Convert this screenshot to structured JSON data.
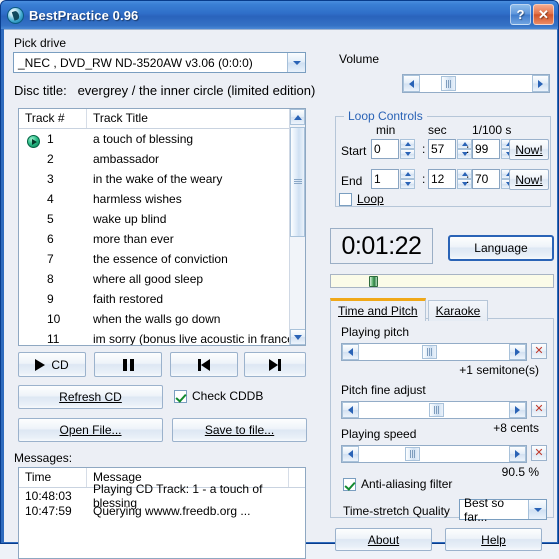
{
  "window": {
    "title": "BestPractice 0.96",
    "icon": "cd-disc-icon",
    "help_button": "?",
    "close_button": "✕"
  },
  "drive": {
    "label": "Pick drive",
    "selected": "_NEC   , DVD_RW ND-3520AW v3.06 (0:0:0)"
  },
  "disc": {
    "label": "Disc title:",
    "title": "evergrey / the inner circle (limited edition)"
  },
  "tracklist": {
    "columns": [
      "Track #",
      "Track Title"
    ],
    "playing_index": 1,
    "rows": [
      {
        "num": "1",
        "title": "a touch of blessing"
      },
      {
        "num": "2",
        "title": "ambassador"
      },
      {
        "num": "3",
        "title": "in the wake of the weary"
      },
      {
        "num": "4",
        "title": "harmless wishes"
      },
      {
        "num": "5",
        "title": "wake up blind"
      },
      {
        "num": "6",
        "title": "more than ever"
      },
      {
        "num": "7",
        "title": "the essence of conviction"
      },
      {
        "num": "8",
        "title": "where all good sleep"
      },
      {
        "num": "9",
        "title": "faith restored"
      },
      {
        "num": "10",
        "title": "when the walls go down"
      },
      {
        "num": "11",
        "title": "im sorry (bonus live acoustic in france)"
      }
    ]
  },
  "transport": {
    "play_label": "CD",
    "pause_label": "",
    "prev_label": "",
    "next_label": "",
    "refresh_label": "Refresh CD",
    "open_label": "Open File...",
    "save_label": "Save to file...",
    "check_cddb_label": "Check CDDB",
    "check_cddb_checked": true
  },
  "messages": {
    "label": "Messages:",
    "columns": [
      "Time",
      "Message"
    ],
    "rows": [
      {
        "time": "10:48:03",
        "message": "Playing CD Track: 1 - a touch of blessing"
      },
      {
        "time": "10:47:59",
        "message": "Querying wwww.freedb.org ..."
      }
    ]
  },
  "volume": {
    "label": "Volume",
    "thumb_percent": 22
  },
  "loop": {
    "title": "Loop Controls",
    "col_min": "min",
    "col_sec": "sec",
    "col_cent": "1/100 s",
    "start_label": "Start",
    "end_label": "End",
    "start_min": "0",
    "start_sec": "57",
    "start_cent": "99",
    "end_min": "1",
    "end_sec": "12",
    "end_cent": "70",
    "now_label": "Now!",
    "loop_checkbox_label": "Loop",
    "loop_checked": false,
    "separator": ":"
  },
  "playback": {
    "time": "0:01:22",
    "language_button": "Language",
    "progress_percent": 18
  },
  "tabs": [
    {
      "label": "Time and Pitch",
      "active": true
    },
    {
      "label": "Karaoke",
      "active": false
    }
  ],
  "pitch_panel": {
    "playing_pitch_label": "Playing pitch",
    "playing_pitch_value": "+1 semitone(s)",
    "playing_pitch_thumb_percent": 47,
    "pitch_fine_label": "Pitch fine adjust",
    "pitch_fine_value": "+8 cents",
    "pitch_fine_thumb_percent": 52,
    "playing_speed_label": "Playing speed",
    "playing_speed_value": "90.5 %",
    "playing_speed_thumb_percent": 34,
    "reset_glyph": "✕",
    "anti_alias_label": "Anti-aliasing filter",
    "anti_alias_checked": true,
    "quality_label": "Time-stretch Quality",
    "quality_value": "Best so far..."
  },
  "footer": {
    "about_label": "About",
    "help_label": "Help"
  },
  "colors": {
    "titlebar": "#2f6bbd",
    "accent_tab": "#f0a818",
    "group_title": "#2a63b6",
    "play_marker": "#2fbf8a",
    "progress_thumb": "#4fa861"
  }
}
